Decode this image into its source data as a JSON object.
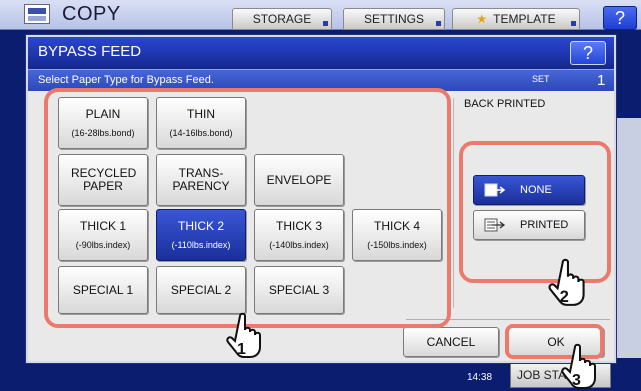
{
  "app": {
    "title": "COPY",
    "tabs": [
      "STORAGE",
      "SETTINGS",
      "TEMPLATE"
    ],
    "help": "?"
  },
  "dialog": {
    "title": "BYPASS FEED",
    "help": "?",
    "instruction": "Select Paper Type for Bypass Feed.",
    "set_label": "SET",
    "set_count": "1",
    "paper_types": [
      {
        "label": "PLAIN",
        "sub": "(16-28lbs.bond)",
        "selected": false
      },
      {
        "label": "THIN",
        "sub": "(14-16lbs.bond)",
        "selected": false
      },
      {
        "label": "RECYCLED PAPER",
        "sub": "",
        "selected": false
      },
      {
        "label": "TRANS-PARENCY",
        "sub": "",
        "selected": false
      },
      {
        "label": "ENVELOPE",
        "sub": "",
        "selected": false
      },
      {
        "label": "THICK 1",
        "sub": "(-90lbs.index)",
        "selected": false
      },
      {
        "label": "THICK 2",
        "sub": "(-110lbs.index)",
        "selected": true
      },
      {
        "label": "THICK 3",
        "sub": "(-140lbs.index)",
        "selected": false
      },
      {
        "label": "THICK 4",
        "sub": "(-150lbs.index)",
        "selected": false
      },
      {
        "label": "SPECIAL 1",
        "sub": "",
        "selected": false
      },
      {
        "label": "SPECIAL 2",
        "sub": "",
        "selected": false
      },
      {
        "label": "SPECIAL 3",
        "sub": "",
        "selected": false
      }
    ],
    "back_printed": {
      "label": "BACK PRINTED",
      "options": [
        {
          "label": "NONE",
          "selected": true
        },
        {
          "label": "PRINTED",
          "selected": false
        }
      ]
    },
    "cancel": "CANCEL",
    "ok": "OK"
  },
  "status": {
    "clock": "14:38",
    "job_status": "JOB STATUS"
  },
  "callouts": [
    "1",
    "2",
    "3"
  ],
  "colors": {
    "callout": "#ec7a6c",
    "selected": "#1a2f9a",
    "header": "#14288f"
  }
}
